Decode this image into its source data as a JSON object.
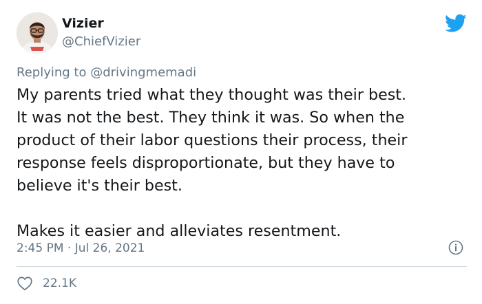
{
  "author": {
    "display_name": "Vizier",
    "handle": "@ChiefVizier",
    "avatar_icon": "user-avatar"
  },
  "reply": {
    "prefix": "Replying to",
    "mention": "@drivingmemadi"
  },
  "tweet": {
    "lines": [
      "My parents tried what they thought was their best.",
      "It was not the best. They think it was. So when the",
      "product of their labor questions their process, their",
      "response feels disproportionate, but they have to",
      "believe it's their best."
    ],
    "second_paragraph": "Makes it easier and alleviates resentment."
  },
  "meta": {
    "timestamp": "2:45 PM · Jul 26, 2021"
  },
  "stats": {
    "likes": "22.1K"
  },
  "icons": {
    "brand": "twitter-bird-icon",
    "info": "info-icon",
    "like": "heart-icon"
  },
  "colors": {
    "twitter_blue": "#1da1f2",
    "secondary_text": "#657786",
    "primary_text": "#14171a",
    "divider": "#cfd9de"
  }
}
